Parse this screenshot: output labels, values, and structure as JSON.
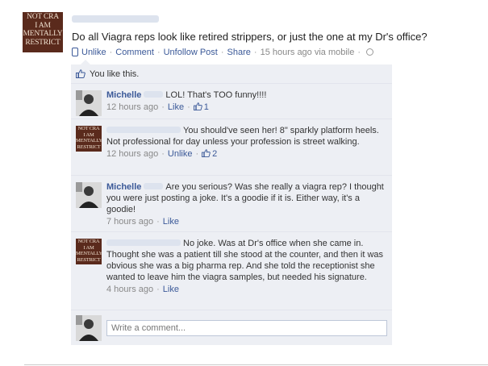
{
  "post": {
    "author_badge_lines": [
      "NOT CRA",
      "I AM",
      "MENTALLY",
      "RESTRICT"
    ],
    "text": "Do all Viagra reps look like retired strippers, or just the one at my Dr's office?",
    "actions": {
      "unlike": "Unlike",
      "comment": "Comment",
      "unfollow": "Unfollow Post",
      "share": "Share"
    },
    "timestamp": "15 hours ago via mobile"
  },
  "likes": {
    "text": "You like this."
  },
  "comments": [
    {
      "author": "Michelle",
      "text": "LOL! That's TOO funny!!!!",
      "time": "12 hours ago",
      "action": "Like",
      "like_count": "1",
      "avatar": "photo"
    },
    {
      "author": "",
      "text": "You should've seen her! 8\" sparkly platform heels. Not professional for day unless your profession is street walking.",
      "time": "12 hours ago",
      "action": "Unlike",
      "like_count": "2",
      "avatar": "badge"
    },
    {
      "author": "Michelle",
      "text": "Are you serious? Was she really a viagra rep? I thought you were just posting a joke. It's a goodie if it is. Either way, it's a goodie!",
      "time": "7 hours ago",
      "action": "Like",
      "like_count": "",
      "avatar": "photo"
    },
    {
      "author": "",
      "text": "No joke. Was at Dr's office when she came in. Thought she was a patient till she stood at the counter, and then it was obvious she was a big pharma rep. And she told the receptionist she wanted to leave him the viagra samples, but needed his signature.",
      "time": "4 hours ago",
      "action": "Like",
      "like_count": "",
      "avatar": "badge"
    }
  ],
  "composer": {
    "placeholder": "Write a comment..."
  },
  "colors": {
    "link": "#3b5998",
    "ufi_bg": "#edeff4",
    "badge_bg": "#5a2a1c"
  },
  "icons": {
    "mobile": "phone-icon",
    "privacy": "globe-icon",
    "like": "thumbs-up-icon"
  }
}
